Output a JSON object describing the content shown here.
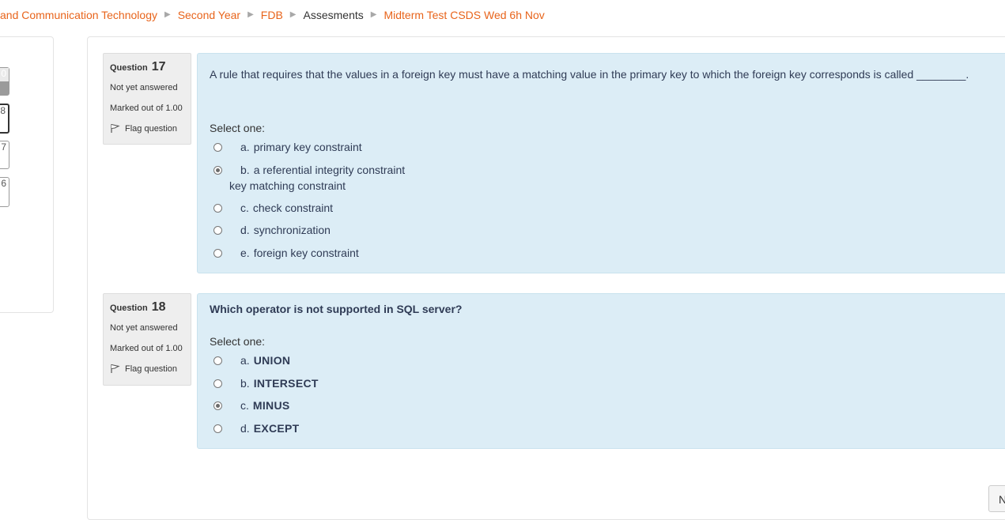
{
  "breadcrumb": {
    "items": [
      {
        "label": "and Communication Technology",
        "type": "link"
      },
      {
        "label": "Second Year",
        "type": "link"
      },
      {
        "label": "FDB",
        "type": "link"
      },
      {
        "label": "Assesments",
        "type": "current"
      },
      {
        "label": "Midterm Test CSDS Wed 6h Nov",
        "type": "link"
      }
    ],
    "separator": "▶"
  },
  "quiz_nav": {
    "buttons": [
      {
        "label": "0",
        "state": "answered"
      },
      {
        "label": "8",
        "state": "current"
      },
      {
        "label": "7",
        "state": "normal"
      },
      {
        "label": "6",
        "state": "normal"
      }
    ]
  },
  "questions": [
    {
      "number_prefix": "Question",
      "number": "17",
      "state": "Not yet answered",
      "grade": "Marked out of 1.00",
      "flag_label": "Flag question",
      "text": "A rule that requires that the values in a foreign key must have a matching value in the primary key to which the foreign key corresponds is called ________.",
      "prompt": "Select one:",
      "options": [
        {
          "num": "a.",
          "text": "primary key constraint",
          "checked": false
        },
        {
          "num": "b.",
          "text": "a referential integrity constraint",
          "extra": "key matching constraint",
          "checked": true
        },
        {
          "num": "c.",
          "text": "check constraint",
          "checked": false
        },
        {
          "num": "d.",
          "text": "synchronization",
          "checked": false
        },
        {
          "num": "e.",
          "text": "foreign key constraint",
          "checked": false
        }
      ]
    },
    {
      "number_prefix": "Question",
      "number": "18",
      "state": "Not yet answered",
      "grade": "Marked out of 1.00",
      "flag_label": "Flag question",
      "text": "Which operator is not supported in SQL server?",
      "prompt": "Select one:",
      "options": [
        {
          "num": "a.",
          "text": "UNION",
          "checked": false
        },
        {
          "num": "b.",
          "text": "INTERSECT",
          "checked": false
        },
        {
          "num": "c.",
          "text": "MINUS",
          "checked": true
        },
        {
          "num": "d.",
          "text": "EXCEPT",
          "checked": false
        }
      ]
    }
  ],
  "next_button": {
    "label": "N"
  },
  "colors": {
    "link": "#e8641b",
    "content_bg": "#dcedf6",
    "info_bg": "#eeeeee",
    "text_dark": "#2f3b55"
  },
  "icons": {
    "flag": "flag-icon",
    "breadcrumb_separator": "triangle-right-icon"
  }
}
